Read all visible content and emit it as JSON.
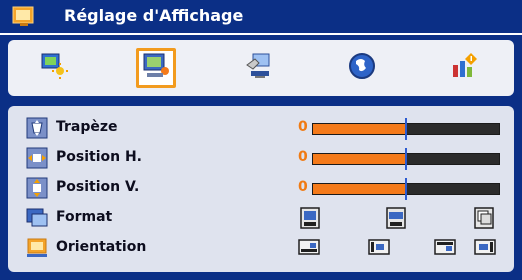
{
  "menu": {
    "title": "Réglage d'Affichage",
    "title_icon": "display-settings-icon"
  },
  "tabs": [
    {
      "name": "image-settings-icon",
      "selected": false
    },
    {
      "name": "display-settings-icon",
      "selected": true
    },
    {
      "name": "system-settings-icon",
      "selected": false
    },
    {
      "name": "language-globe-icon",
      "selected": false
    },
    {
      "name": "advanced-settings-icon",
      "selected": false
    }
  ],
  "settings": {
    "trapeze": {
      "label": "Trapèze",
      "value": "0",
      "fill_fraction": 0.5,
      "icon": "keystone-icon"
    },
    "position_h": {
      "label": "Position H.",
      "value": "0",
      "fill_fraction": 0.5,
      "icon": "horizontal-position-icon"
    },
    "position_v": {
      "label": "Position V.",
      "value": "0",
      "fill_fraction": 0.5,
      "icon": "vertical-position-icon"
    },
    "format": {
      "label": "Format",
      "icon": "format-icon",
      "options": [
        "aspect-4-3-icon",
        "aspect-16-9-icon",
        "aspect-native-icon"
      ]
    },
    "orientation": {
      "label": "Orientation",
      "icon": "orientation-icon",
      "options": [
        "front-desktop-icon",
        "rear-desktop-icon",
        "front-ceiling-icon",
        "rear-ceiling-icon"
      ]
    }
  },
  "colors": {
    "accent": "#f29b1e",
    "background": "#0b2f86",
    "slider_fill": "#f47a1a",
    "slider_track": "#2b2b2b",
    "slider_marker": "#2c5bd0",
    "value_text": "#f07b14"
  }
}
